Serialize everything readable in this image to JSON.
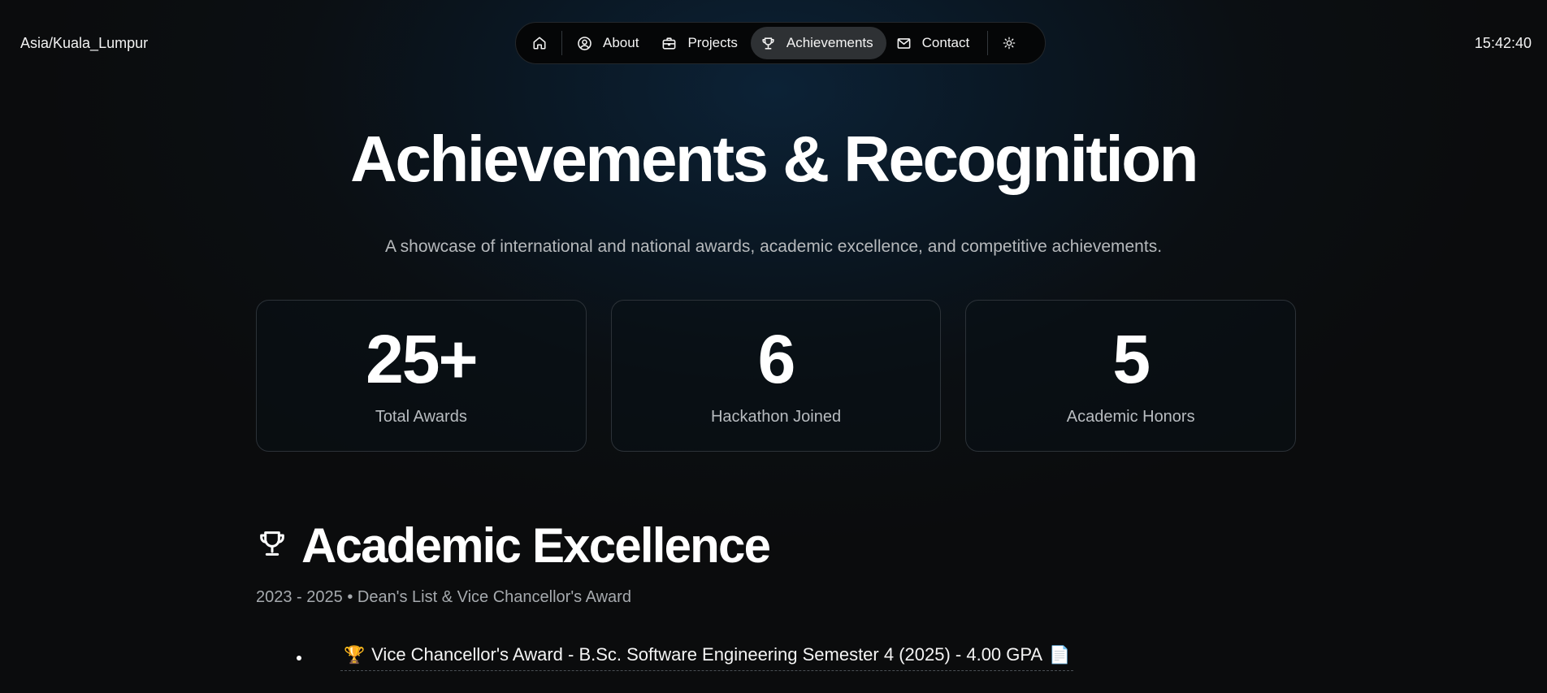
{
  "header": {
    "timezone": "Asia/Kuala_Lumpur",
    "clock": "15:42:40"
  },
  "nav": {
    "items": [
      {
        "label": "About",
        "icon": "user-circle-icon"
      },
      {
        "label": "Projects",
        "icon": "briefcase-icon"
      },
      {
        "label": "Achievements",
        "icon": "trophy-icon",
        "active": true
      },
      {
        "label": "Contact",
        "icon": "mail-icon"
      }
    ],
    "home_icon": "home-icon",
    "theme_icon": "sun-icon"
  },
  "hero": {
    "title": "Achievements & Recognition",
    "subtitle": "A showcase of international and national awards, academic excellence, and competitive achievements."
  },
  "stats": [
    {
      "value": "25+",
      "label": "Total Awards"
    },
    {
      "value": "6",
      "label": "Hackathon Joined"
    },
    {
      "value": "5",
      "label": "Academic Honors"
    }
  ],
  "section": {
    "icon": "trophy-icon",
    "title": "Academic Excellence",
    "meta": "2023 - 2025 • Dean's List & Vice Chancellor's Award",
    "awards": [
      {
        "emoji": "🏆",
        "text": "Vice Chancellor's Award - B.Sc. Software Engineering Semester 4 (2025) - 4.00 GPA",
        "doc_emoji": "📄"
      }
    ]
  },
  "colors": {
    "background": "#0b0c0d",
    "glow": "#0c2236",
    "active_pill": "#2e3134",
    "muted_text": "#b6b9bc"
  }
}
